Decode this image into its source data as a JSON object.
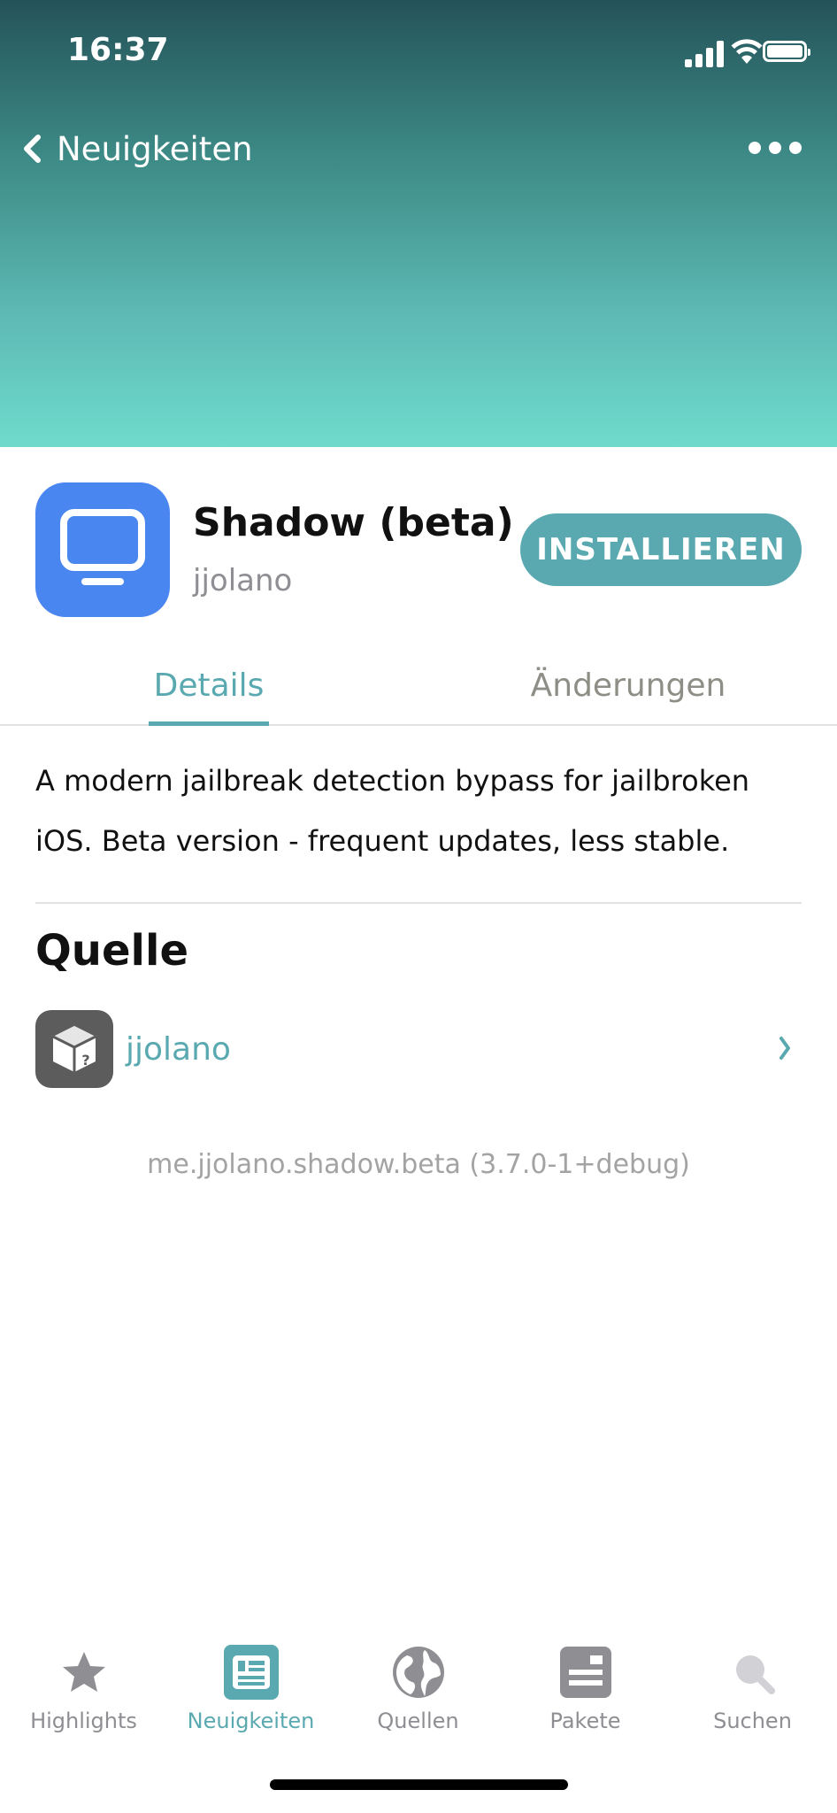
{
  "status_bar": {
    "time": "16:37"
  },
  "nav": {
    "back_label": "Neuigkeiten"
  },
  "package": {
    "name": "Shadow (beta)",
    "author": "jjolano",
    "install_label": "INSTALLIEREN",
    "icon": "monitor-icon",
    "icon_color": "#4a86f0"
  },
  "tabs": [
    {
      "label": "Details",
      "active": true
    },
    {
      "label": "Änderungen",
      "active": false
    }
  ],
  "description": "A modern jailbreak detection bypass for jailbroken iOS. Beta version - frequent updates, less stable.",
  "source_section": {
    "title": "Quelle",
    "source_name": "jjolano",
    "source_icon": "package-box-icon"
  },
  "package_id": "me.jjolano.shadow.beta (3.7.0-1+debug)",
  "tabbar": [
    {
      "label": "Highlights",
      "icon": "star-icon",
      "active": false
    },
    {
      "label": "Neuigkeiten",
      "icon": "newspaper-icon",
      "active": true
    },
    {
      "label": "Quellen",
      "icon": "globe-icon",
      "active": false
    },
    {
      "label": "Pakete",
      "icon": "package-icon",
      "active": false
    },
    {
      "label": "Suchen",
      "icon": "search-icon",
      "active": false
    }
  ],
  "colors": {
    "accent": "#5aa9b0",
    "header_top": "#24535a",
    "header_bottom": "#6fdbcd"
  }
}
